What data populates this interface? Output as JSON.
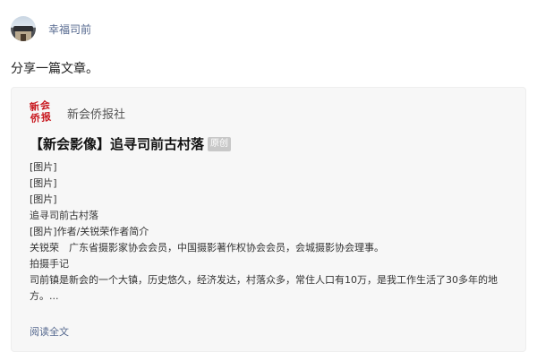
{
  "header": {
    "username": "幸福司前"
  },
  "post": {
    "text": "分享一篇文章。"
  },
  "card": {
    "source_logo_line1": "新会",
    "source_logo_line2": "侨报",
    "source_name": "新会侨报社",
    "title": "【新会影像】追寻司前古村落",
    "badge": "原创",
    "lines": [
      "[图片]",
      "[图片]",
      "[图片]",
      "追寻司前古村落",
      "[图片]作者/关锐荣作者简介",
      "关锐荣　广东省摄影家协会会员，中国摄影著作权协会会员，会城摄影协会理事。",
      "拍摄手记",
      "司前镇是新会的一个大镇，历史悠久，经济发达，村落众多，常住人口有10万，是我工作生活了30多年的地方。..."
    ],
    "read_more": "阅读全文"
  }
}
